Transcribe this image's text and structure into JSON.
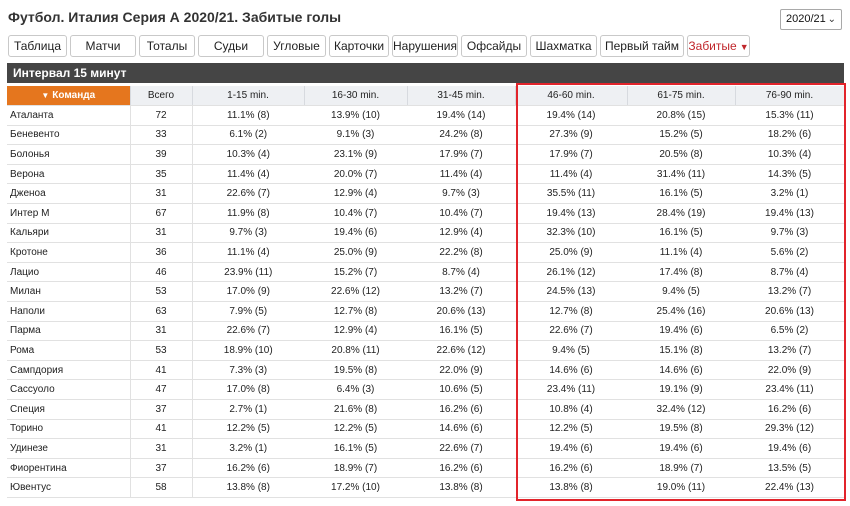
{
  "title": "Футбол. Италия Серия А 2020/21. Забитые голы",
  "season_select": {
    "value": "2020/21"
  },
  "tabs": [
    {
      "label": "Таблица"
    },
    {
      "label": "Матчи"
    },
    {
      "label": "Тоталы"
    },
    {
      "label": "Судьи"
    },
    {
      "label": "Угловые"
    },
    {
      "label": "Карточки"
    },
    {
      "label": "Нарушения"
    },
    {
      "label": "Офсайды"
    },
    {
      "label": "Шахматка"
    },
    {
      "label": "Первый тайм"
    },
    {
      "label": "Забитые"
    }
  ],
  "interval_label": "Интервал 15 минут",
  "columns": [
    "Команда",
    "Всего",
    "1-15 min.",
    "16-30 min.",
    "31-45 min.",
    "46-60 min.",
    "61-75 min.",
    "76-90 min."
  ],
  "rows": [
    [
      "Аталанта",
      "72",
      "11.1% (8)",
      "13.9% (10)",
      "19.4% (14)",
      "19.4% (14)",
      "20.8% (15)",
      "15.3% (11)"
    ],
    [
      "Беневенто",
      "33",
      "6.1% (2)",
      "9.1% (3)",
      "24.2% (8)",
      "27.3% (9)",
      "15.2% (5)",
      "18.2% (6)"
    ],
    [
      "Болонья",
      "39",
      "10.3% (4)",
      "23.1% (9)",
      "17.9% (7)",
      "17.9% (7)",
      "20.5% (8)",
      "10.3% (4)"
    ],
    [
      "Верона",
      "35",
      "11.4% (4)",
      "20.0% (7)",
      "11.4% (4)",
      "11.4% (4)",
      "31.4% (11)",
      "14.3% (5)"
    ],
    [
      "Дженоа",
      "31",
      "22.6% (7)",
      "12.9% (4)",
      "9.7% (3)",
      "35.5% (11)",
      "16.1% (5)",
      "3.2% (1)"
    ],
    [
      "Интер М",
      "67",
      "11.9% (8)",
      "10.4% (7)",
      "10.4% (7)",
      "19.4% (13)",
      "28.4% (19)",
      "19.4% (13)"
    ],
    [
      "Кальяри",
      "31",
      "9.7% (3)",
      "19.4% (6)",
      "12.9% (4)",
      "32.3% (10)",
      "16.1% (5)",
      "9.7% (3)"
    ],
    [
      "Кротоне",
      "36",
      "11.1% (4)",
      "25.0% (9)",
      "22.2% (8)",
      "25.0% (9)",
      "11.1% (4)",
      "5.6% (2)"
    ],
    [
      "Лацио",
      "46",
      "23.9% (11)",
      "15.2% (7)",
      "8.7% (4)",
      "26.1% (12)",
      "17.4% (8)",
      "8.7% (4)"
    ],
    [
      "Милан",
      "53",
      "17.0% (9)",
      "22.6% (12)",
      "13.2% (7)",
      "24.5% (13)",
      "9.4% (5)",
      "13.2% (7)"
    ],
    [
      "Наполи",
      "63",
      "7.9% (5)",
      "12.7% (8)",
      "20.6% (13)",
      "12.7% (8)",
      "25.4% (16)",
      "20.6% (13)"
    ],
    [
      "Парма",
      "31",
      "22.6% (7)",
      "12.9% (4)",
      "16.1% (5)",
      "22.6% (7)",
      "19.4% (6)",
      "6.5% (2)"
    ],
    [
      "Рома",
      "53",
      "18.9% (10)",
      "20.8% (11)",
      "22.6% (12)",
      "9.4% (5)",
      "15.1% (8)",
      "13.2% (7)"
    ],
    [
      "Сампдория",
      "41",
      "7.3% (3)",
      "19.5% (8)",
      "22.0% (9)",
      "14.6% (6)",
      "14.6% (6)",
      "22.0% (9)"
    ],
    [
      "Сассуоло",
      "47",
      "17.0% (8)",
      "6.4% (3)",
      "10.6% (5)",
      "23.4% (11)",
      "19.1% (9)",
      "23.4% (11)"
    ],
    [
      "Специя",
      "37",
      "2.7% (1)",
      "21.6% (8)",
      "16.2% (6)",
      "10.8% (4)",
      "32.4% (12)",
      "16.2% (6)"
    ],
    [
      "Торино",
      "41",
      "12.2% (5)",
      "12.2% (5)",
      "14.6% (6)",
      "12.2% (5)",
      "19.5% (8)",
      "29.3% (12)"
    ],
    [
      "Удинезе",
      "31",
      "3.2% (1)",
      "16.1% (5)",
      "22.6% (7)",
      "19.4% (6)",
      "19.4% (6)",
      "19.4% (6)"
    ],
    [
      "Фиорентина",
      "37",
      "16.2% (6)",
      "18.9% (7)",
      "16.2% (6)",
      "16.2% (6)",
      "18.9% (7)",
      "13.5% (5)"
    ],
    [
      "Ювентус",
      "58",
      "13.8% (8)",
      "17.2% (10)",
      "13.8% (8)",
      "13.8% (8)",
      "19.0% (11)",
      "22.4% (13)"
    ]
  ],
  "colors": {
    "accent": "#e5761e",
    "interval_bar": "#454545",
    "highlight": "#e2242b",
    "active_tab": "#c0262b"
  },
  "icons": {
    "season_dropdown": "chevron-down-icon",
    "sort": "triangle-down-icon",
    "active_tab": "chevron-down-icon"
  }
}
